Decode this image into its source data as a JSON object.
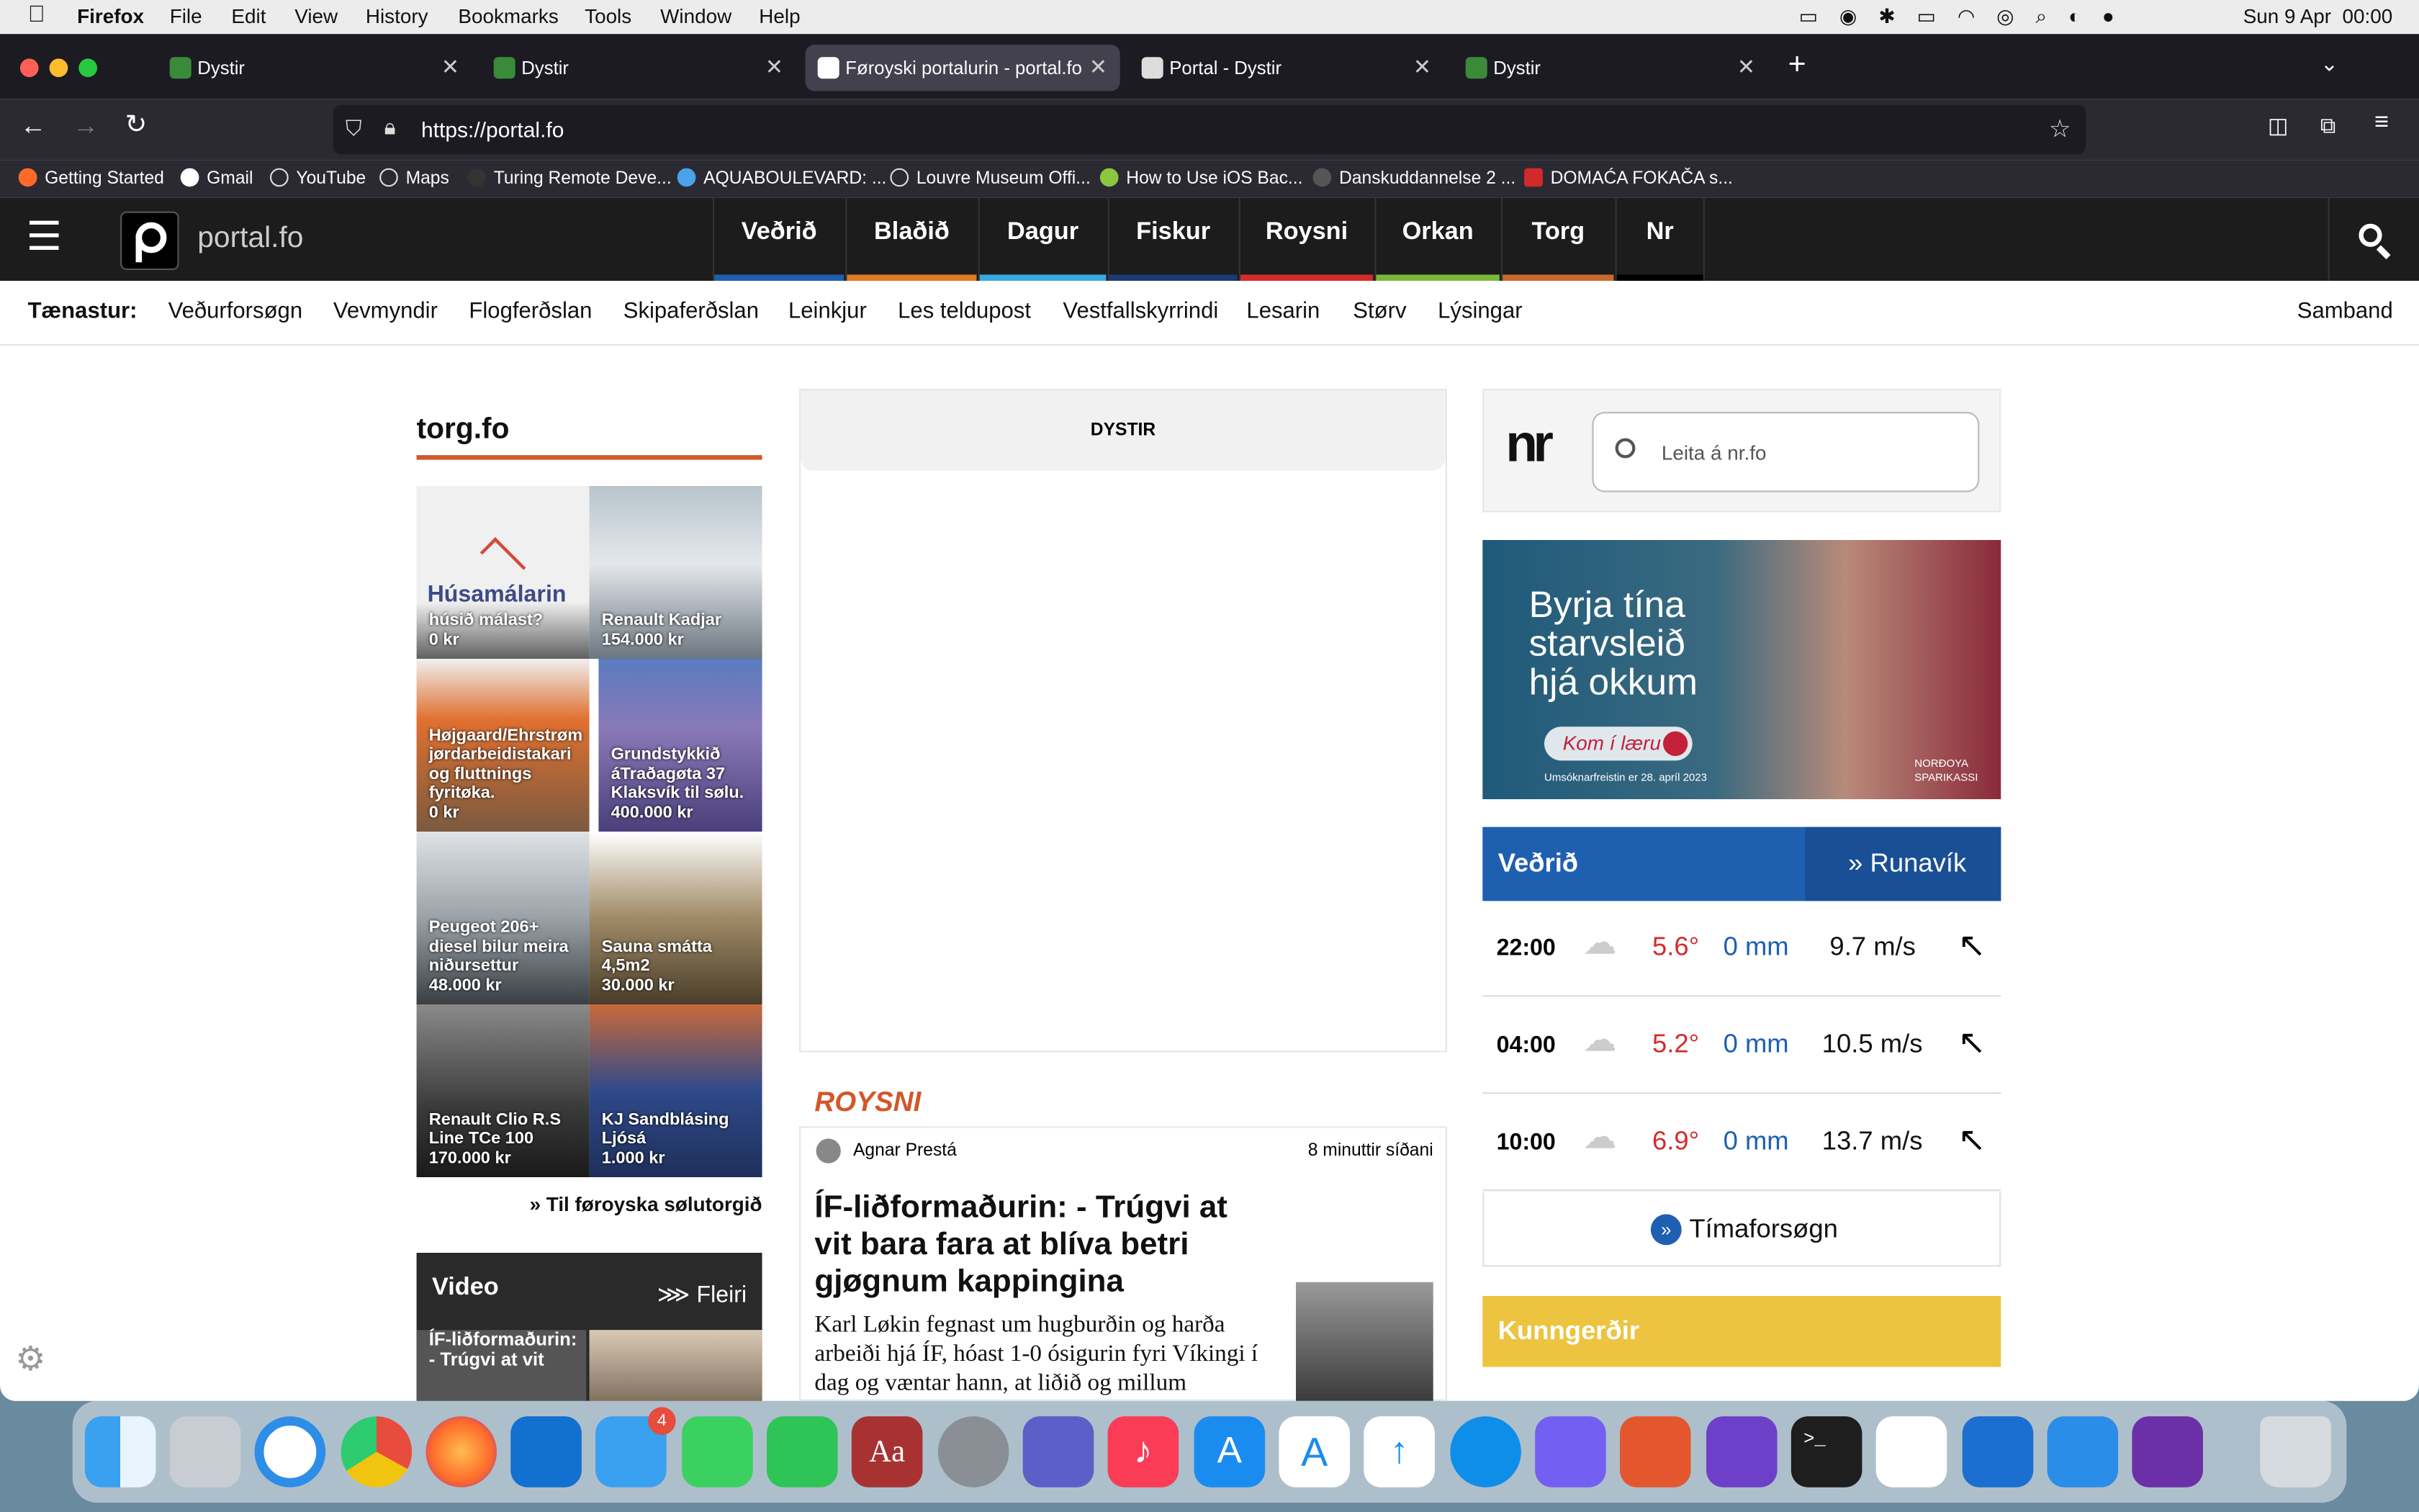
{
  "menubar": {
    "app": "Firefox",
    "items": [
      "File",
      "Edit",
      "View",
      "History",
      "Bookmarks",
      "Tools",
      "Window",
      "Help"
    ],
    "clock": "Sun 9 Apr  00:00"
  },
  "tabs": [
    {
      "title": "Dystir",
      "active": false
    },
    {
      "title": "Dystir",
      "active": false
    },
    {
      "title": "Føroyski portalurin - portal.fo",
      "active": true
    },
    {
      "title": "Portal - Dystir",
      "active": false
    },
    {
      "title": "Dystir",
      "active": false
    }
  ],
  "url": "https://portal.fo",
  "bookmarks": [
    "Getting Started",
    "Gmail",
    "YouTube",
    "Maps",
    "Turing Remote Deve...",
    "AQUABOULEVARD: ...",
    "Louvre Museum Offi...",
    "How to Use iOS Bac...",
    "Danskuddannelse 2 ...",
    "DOMAĆA FOKAČA s..."
  ],
  "site": {
    "logo": "portal.fo",
    "categories": [
      {
        "label": "Veðrið",
        "color": "#1e5fb0"
      },
      {
        "label": "Blaðið",
        "color": "#e07b24"
      },
      {
        "label": "Dagur",
        "color": "#37a9e1"
      },
      {
        "label": "Fiskur",
        "color": "#1b3a74"
      },
      {
        "label": "Roysni",
        "color": "#d42b2b"
      },
      {
        "label": "Orkan",
        "color": "#7ab83a"
      },
      {
        "label": "Torg",
        "color": "#c96a2b"
      },
      {
        "label": "Nr",
        "color": "#111111"
      }
    ],
    "services_label": "Tænastur:",
    "services": [
      "Veðurforsøgn",
      "Vevmyndir",
      "Flogferðslan",
      "Skipaferðslan",
      "Leinkjur",
      "Les teldupost",
      "Vestfallskyrrindi",
      "Lesarin",
      "Størv",
      "Lýsingar"
    ],
    "contact": "Samband"
  },
  "torg": {
    "title": "torg.fo",
    "brand_logo": "Húsamálarin",
    "items": [
      {
        "name": "húsið málast?",
        "price": "0 kr"
      },
      {
        "name": "Renault Kadjar",
        "price": "154.000 kr"
      },
      {
        "name": "Højgaard/Ehrstrøm jørdarbeidistakari og fluttnings fyritøka.",
        "price": "0 kr"
      },
      {
        "name": "Grundstykkið áTraðagøta 37 Klaksvík til sølu.",
        "price": "400.000 kr"
      },
      {
        "name": "Peugeot 206+ diesel bilur meira niðursettur",
        "price": "48.000 kr"
      },
      {
        "name": "Sauna smátta 4,5m2",
        "price": "30.000 kr"
      },
      {
        "name": "Renault Clio R.S Line TCe 100",
        "price": "170.000 kr"
      },
      {
        "name": "KJ Sandblásing Ljósá",
        "price": "1.000 kr"
      }
    ],
    "more": "» Til føroyska sølutorgið"
  },
  "video": {
    "title": "Video",
    "more": "Fleiri",
    "first": "ÍF-liðformaðurin: - Trúgvi at vit"
  },
  "dystir": {
    "label": "DYSTIR"
  },
  "article": {
    "section": "ROYSNI",
    "author": "Agnar Prestá",
    "time": "8 minuttir síðani",
    "headline": "ÍF-liðformaðurin: - Trúgvi at vit bara fara at blíva betri gjøgnum kappingina",
    "lead": "Karl Løkin fegnast um hugburðin og harða arbeiði hjá ÍF, hóast 1-0 ósigurin fyri Víkingi í dag og væntar hann, at liðið og millum"
  },
  "nr": {
    "placeholder": "Leita á nr.fo"
  },
  "ad": {
    "headline": "Byrja tína starvsleið hjá okkum",
    "button": "Kom í læru",
    "footnote": "Umsóknarfreistin er 28. apríl 2023",
    "brand": "NORÐOYA SPARIKASSI"
  },
  "weather": {
    "title": "Veðrið",
    "place": "» Runavík",
    "rows": [
      {
        "time": "22:00",
        "temp": "5.6°",
        "rain": "0 mm",
        "wind": "9.7 m/s"
      },
      {
        "time": "04:00",
        "temp": "5.2°",
        "rain": "0 mm",
        "wind": "10.5 m/s"
      },
      {
        "time": "10:00",
        "temp": "6.9°",
        "rain": "0 mm",
        "wind": "13.7 m/s"
      }
    ],
    "forecast": "Tímaforsøgn"
  },
  "kunngerdir": {
    "title": "Kunngerðir"
  },
  "dock": {
    "mail_badge": "4"
  }
}
